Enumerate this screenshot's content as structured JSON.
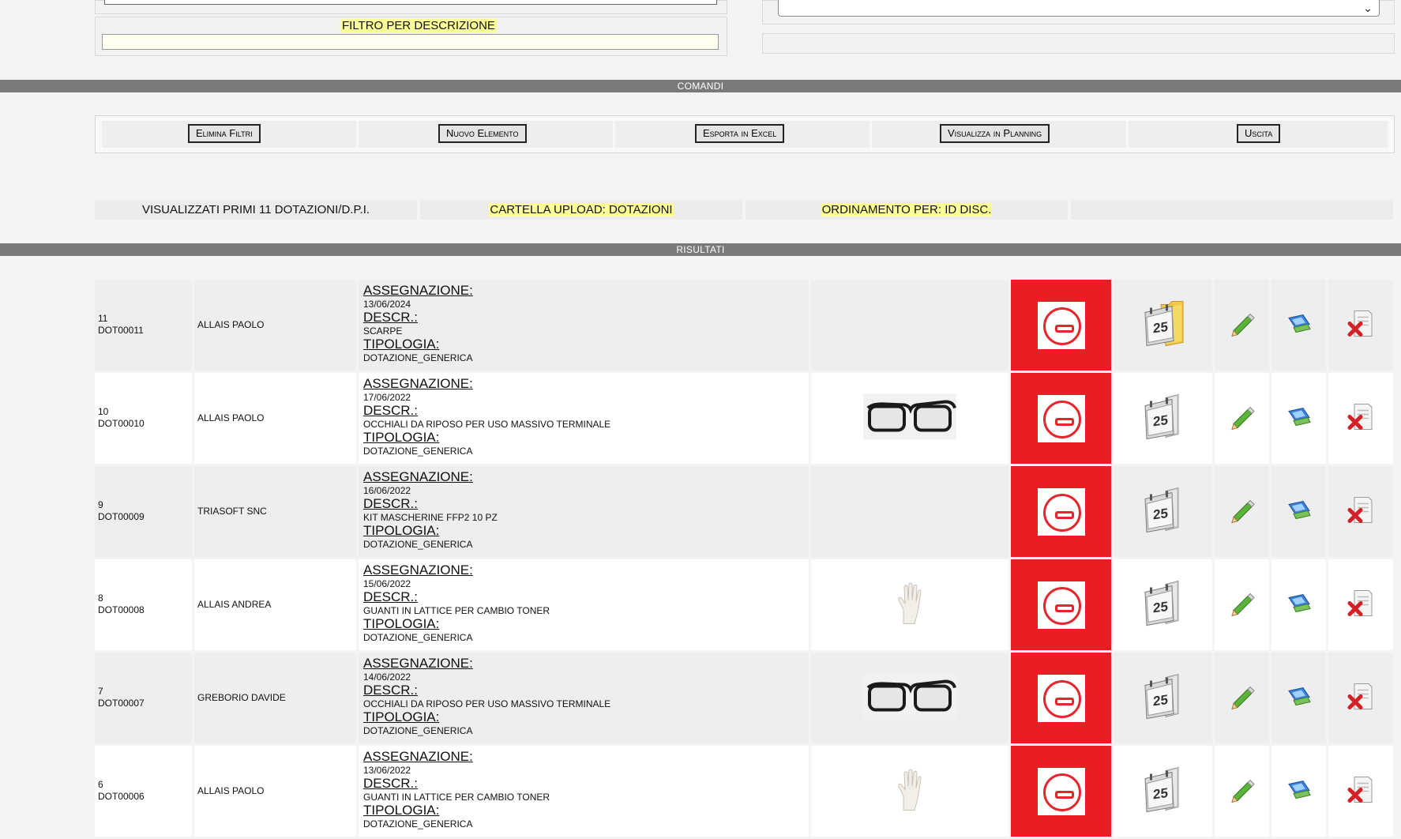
{
  "filters": {
    "description_label": "FILTRO PER DESCRIZIONE",
    "description_value": ""
  },
  "sections": {
    "commands": "COMANDI",
    "results": "RISULTATI"
  },
  "commands": [
    {
      "label": "Elimina Filtri"
    },
    {
      "label": "Nuovo Elemento"
    },
    {
      "label": "Esporta in Excel"
    },
    {
      "label": "Visualizza in Planning"
    },
    {
      "label": "Uscita"
    }
  ],
  "info": {
    "count_text": "VISUALIZZATI PRIMI 11 DOTAZIONI/D.P.I.",
    "upload_folder": "CARTELLA UPLOAD: DOTAZIONI",
    "sort_by": "ORDINAMENTO PER: ID DISC."
  },
  "labels": {
    "assignment": "ASSEGNAZIONE:",
    "description": "DESCR.:",
    "type": "TIPOLOGIA:"
  },
  "rows": [
    {
      "num": "11",
      "code": "DOT00011",
      "person": "ALLAIS PAOLO",
      "date": "13/06/2024",
      "descr": "SCARPE",
      "type": "DOTAZIONE_GENERICA",
      "image": "none",
      "calendar": "calendar-folder-icon"
    },
    {
      "num": "10",
      "code": "DOT00010",
      "person": "ALLAIS PAOLO",
      "date": "17/06/2022",
      "descr": "OCCHIALI DA RIPOSO PER USO MASSIVO TERMINALE",
      "type": "DOTAZIONE_GENERICA",
      "image": "glasses",
      "calendar": "calendar-icon"
    },
    {
      "num": "9",
      "code": "DOT00009",
      "person": "TRIASOFT SNC",
      "date": "16/06/2022",
      "descr": "KIT MASCHERINE FFP2 10 PZ",
      "type": "DOTAZIONE_GENERICA",
      "image": "none",
      "calendar": "calendar-icon"
    },
    {
      "num": "8",
      "code": "DOT00008",
      "person": "ALLAIS ANDREA",
      "date": "15/06/2022",
      "descr": "GUANTI IN LATTICE PER CAMBIO TONER",
      "type": "DOTAZIONE_GENERICA",
      "image": "glove",
      "calendar": "calendar-icon"
    },
    {
      "num": "7",
      "code": "DOT00007",
      "person": "GREBORIO DAVIDE",
      "date": "14/06/2022",
      "descr": "OCCHIALI DA RIPOSO PER USO MASSIVO TERMINALE",
      "type": "DOTAZIONE_GENERICA",
      "image": "glasses",
      "calendar": "calendar-icon"
    },
    {
      "num": "6",
      "code": "DOT00006",
      "person": "ALLAIS PAOLO",
      "date": "13/06/2022",
      "descr": "GUANTI IN LATTICE PER CAMBIO TONER",
      "type": "DOTAZIONE_GENERICA",
      "image": "glove",
      "calendar": "calendar-icon"
    }
  ],
  "calendar_day": "25",
  "colors": {
    "band": "#7a7a7a",
    "highlight": "#ffff99",
    "stop_red": "#ec1c24",
    "row_odd": "#eeeeee",
    "row_even": "#ffffff"
  }
}
